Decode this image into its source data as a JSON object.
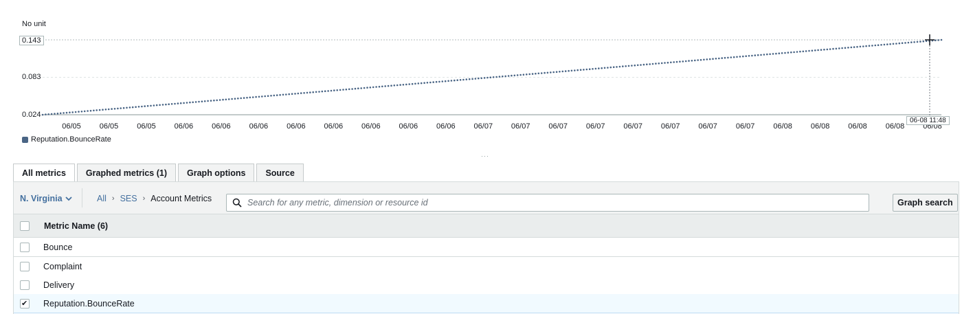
{
  "chart_data": {
    "type": "scatter",
    "unit_label": "No unit",
    "y_ticks": [
      "0.024",
      "0.083",
      "0.143"
    ],
    "ylim": [
      0.024,
      0.143
    ],
    "x_ticks": [
      "06/05",
      "06/05",
      "06/05",
      "06/06",
      "06/06",
      "06/06",
      "06/06",
      "06/06",
      "06/06",
      "06/06",
      "06/06",
      "06/07",
      "06/07",
      "06/07",
      "06/07",
      "06/07",
      "06/07",
      "06/07",
      "06/07",
      "06/08",
      "06/08",
      "06/08",
      "06/08",
      "06/08"
    ],
    "series": [
      {
        "name": "Reputation.BounceRate",
        "color": "#4a6585",
        "start_value": 0.024,
        "end_value": 0.143,
        "trend": "linear-increase"
      }
    ],
    "cursor_label": "06-08 11:48",
    "grid": true,
    "legend_position": "bottom-left"
  },
  "tabs": [
    {
      "label": "All metrics",
      "active": true
    },
    {
      "label": "Graphed metrics (1)",
      "active": false
    },
    {
      "label": "Graph options",
      "active": false
    },
    {
      "label": "Source",
      "active": false
    }
  ],
  "toolbar": {
    "region": "N. Virginia",
    "breadcrumb": {
      "all": "All",
      "ses": "SES",
      "current": "Account Metrics"
    },
    "search_placeholder": "Search for any metric, dimension or resource id",
    "graph_search_label": "Graph search"
  },
  "table": {
    "header": "Metric Name  (6)",
    "rows": [
      {
        "label": "Bounce",
        "checked": false
      },
      {
        "label": "Complaint",
        "checked": false
      },
      {
        "label": "Delivery",
        "checked": false
      },
      {
        "label": "Reputation.BounceRate",
        "checked": true
      }
    ]
  },
  "colors": {
    "accent_link": "#44709f",
    "series": "#4a6585",
    "selected_row": "#f1faff"
  }
}
